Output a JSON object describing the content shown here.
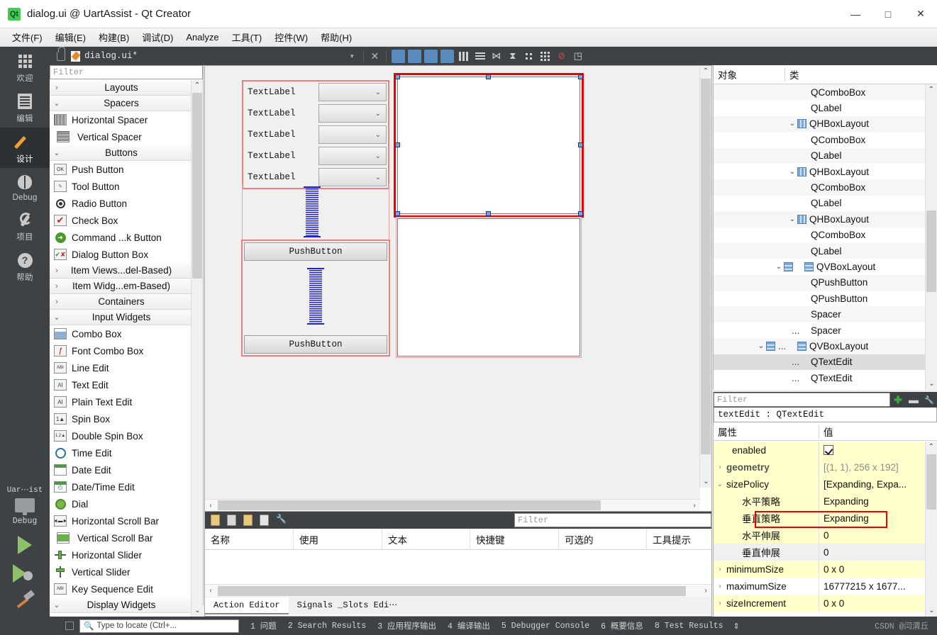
{
  "window": {
    "title": "dialog.ui @ UartAssist - Qt Creator",
    "logo_text": "Qt",
    "minimize": "—",
    "maximize": "□",
    "close": "✕"
  },
  "menubar": {
    "items": [
      {
        "label": "文件(F)",
        "mnemonic": "F"
      },
      {
        "label": "编辑(E)",
        "mnemonic": "E"
      },
      {
        "label": "构建(B)",
        "mnemonic": "B"
      },
      {
        "label": "调试(D)",
        "mnemonic": "D"
      },
      {
        "label": "Analyze",
        "mnemonic": "A"
      },
      {
        "label": "工具(T)",
        "mnemonic": "T"
      },
      {
        "label": "控件(W)",
        "mnemonic": "W"
      },
      {
        "label": "帮助(H)",
        "mnemonic": "H"
      }
    ]
  },
  "modebar": {
    "items": [
      {
        "label": "欢迎",
        "icon": "grid-icon",
        "active": false
      },
      {
        "label": "编辑",
        "icon": "document-icon",
        "active": false
      },
      {
        "label": "设计",
        "icon": "pencil-icon",
        "active": true
      },
      {
        "label": "Debug",
        "icon": "bug-icon",
        "active": false
      },
      {
        "label": "项目",
        "icon": "wrench-icon",
        "active": false
      },
      {
        "label": "帮助",
        "icon": "question-icon",
        "active": false
      }
    ],
    "kit": {
      "project": "Uar⋯ist",
      "build_config": "Debug"
    }
  },
  "editbar": {
    "filename": "dialog.ui*",
    "dropdown": "▾",
    "close": "✕"
  },
  "widgetbox": {
    "filter_placeholder": "Filter",
    "groups": [
      {
        "label": "Layouts",
        "expanded": false,
        "items": []
      },
      {
        "label": "Spacers",
        "expanded": true,
        "items": [
          {
            "label": "Horizontal Spacer",
            "icon": "horizontal-spacer-icon"
          },
          {
            "label": "Vertical Spacer",
            "icon": "vertical-spacer-icon"
          }
        ]
      },
      {
        "label": "Buttons",
        "expanded": true,
        "items": [
          {
            "label": "Push Button",
            "icon": "push-button-icon"
          },
          {
            "label": "Tool Button",
            "icon": "tool-button-icon"
          },
          {
            "label": "Radio Button",
            "icon": "radio-button-icon"
          },
          {
            "label": "Check Box",
            "icon": "check-box-icon"
          },
          {
            "label": "Command ...k Button",
            "icon": "command-link-icon"
          },
          {
            "label": "Dialog Button Box",
            "icon": "dialog-button-box-icon"
          }
        ]
      },
      {
        "label": "Item Views...del-Based)",
        "expanded": false,
        "items": []
      },
      {
        "label": "Item Widg...em-Based)",
        "expanded": false,
        "items": []
      },
      {
        "label": "Containers",
        "expanded": false,
        "items": []
      },
      {
        "label": "Input Widgets",
        "expanded": true,
        "items": [
          {
            "label": "Combo Box",
            "icon": "combo-box-icon"
          },
          {
            "label": "Font Combo Box",
            "icon": "font-combo-box-icon"
          },
          {
            "label": "Line Edit",
            "icon": "line-edit-icon"
          },
          {
            "label": "Text Edit",
            "icon": "text-edit-icon"
          },
          {
            "label": "Plain Text Edit",
            "icon": "plain-text-edit-icon"
          },
          {
            "label": "Spin Box",
            "icon": "spin-box-icon"
          },
          {
            "label": "Double Spin Box",
            "icon": "double-spin-box-icon"
          },
          {
            "label": "Time Edit",
            "icon": "time-edit-icon"
          },
          {
            "label": "Date Edit",
            "icon": "date-edit-icon"
          },
          {
            "label": "Date/Time Edit",
            "icon": "date-time-edit-icon"
          },
          {
            "label": "Dial",
            "icon": "dial-icon"
          },
          {
            "label": "Horizontal Scroll Bar",
            "icon": "horizontal-scroll-bar-icon"
          },
          {
            "label": "Vertical Scroll Bar",
            "icon": "vertical-scroll-bar-icon"
          },
          {
            "label": "Horizontal Slider",
            "icon": "horizontal-slider-icon"
          },
          {
            "label": "Vertical Slider",
            "icon": "vertical-slider-icon"
          },
          {
            "label": "Key Sequence Edit",
            "icon": "key-sequence-edit-icon"
          }
        ]
      },
      {
        "label": "Display Widgets",
        "expanded": true,
        "items": []
      }
    ]
  },
  "canvas": {
    "labels": [
      "TextLabel",
      "TextLabel",
      "TextLabel",
      "TextLabel",
      "TextLabel"
    ],
    "buttons": [
      "PushButton",
      "PushButton"
    ],
    "selected_widget": "textEdit"
  },
  "object_inspector": {
    "col_object": "对象",
    "col_class": "类",
    "rows": [
      {
        "object": "",
        "cls": "QComboBox",
        "depth": 3,
        "chev": "",
        "icon": ""
      },
      {
        "object": "",
        "cls": "QLabel",
        "depth": 3,
        "chev": "",
        "icon": ""
      },
      {
        "object": "",
        "cls": "QHBoxLayout",
        "depth": 2,
        "chev": "⌄",
        "icon": "hbox"
      },
      {
        "object": "",
        "cls": "QComboBox",
        "depth": 3,
        "chev": "",
        "icon": ""
      },
      {
        "object": "",
        "cls": "QLabel",
        "depth": 3,
        "chev": "",
        "icon": ""
      },
      {
        "object": "",
        "cls": "QHBoxLayout",
        "depth": 2,
        "chev": "⌄",
        "icon": "hbox"
      },
      {
        "object": "",
        "cls": "QComboBox",
        "depth": 3,
        "chev": "",
        "icon": ""
      },
      {
        "object": "",
        "cls": "QLabel",
        "depth": 3,
        "chev": "",
        "icon": ""
      },
      {
        "object": "",
        "cls": "QHBoxLayout",
        "depth": 2,
        "chev": "⌄",
        "icon": "hbox"
      },
      {
        "object": "",
        "cls": "QComboBox",
        "depth": 3,
        "chev": "",
        "icon": ""
      },
      {
        "object": "",
        "cls": "QLabel",
        "depth": 3,
        "chev": "",
        "icon": ""
      },
      {
        "object": "",
        "cls": "QVBoxLayout",
        "depth": 2,
        "chev": "⌄",
        "icon": "vbox2"
      },
      {
        "object": "",
        "cls": "QPushButton",
        "depth": 3,
        "chev": "",
        "icon": ""
      },
      {
        "object": "",
        "cls": "QPushButton",
        "depth": 3,
        "chev": "",
        "icon": ""
      },
      {
        "object": "",
        "cls": "Spacer",
        "depth": 3,
        "chev": "",
        "icon": ""
      },
      {
        "object": "...",
        "cls": "Spacer",
        "depth": 3,
        "chev": "",
        "icon": ""
      },
      {
        "object": "...",
        "cls": "QVBoxLayout",
        "depth": 1,
        "chev": "⌄",
        "icon": "vbox2"
      },
      {
        "object": "...",
        "cls": "QTextEdit",
        "depth": 2,
        "chev": "",
        "icon": "",
        "selected": true
      },
      {
        "object": "...",
        "cls": "QTextEdit",
        "depth": 2,
        "chev": "",
        "icon": ""
      }
    ]
  },
  "property_editor": {
    "filter_placeholder": "Filter",
    "object_line": "textEdit : QTextEdit",
    "col_property": "属性",
    "col_value": "值",
    "toolbar": {
      "add": "✚",
      "remove": "▬",
      "config": "🔧"
    },
    "rows": [
      {
        "name": "enabled",
        "value": "",
        "indent": 1,
        "chev": "",
        "bg": "yellow",
        "kind": "checkbox"
      },
      {
        "name": "geometry",
        "value": "[(1, 1), 256 x 192]",
        "indent": 0,
        "chev": "›",
        "bg": "yellow",
        "bold": true,
        "grayvalue": true
      },
      {
        "name": "sizePolicy",
        "value": "[Expanding, Expa...",
        "indent": 0,
        "chev": "⌄",
        "bg": "yellow"
      },
      {
        "name": "水平策略",
        "value": "Expanding",
        "indent": 2,
        "chev": "",
        "bg": "yellow"
      },
      {
        "name": "垂直策略",
        "value": "Expanding",
        "indent": 2,
        "chev": "",
        "bg": "yellow"
      },
      {
        "name": "水平伸展",
        "value": "0",
        "indent": 2,
        "chev": "",
        "bg": "yellow"
      },
      {
        "name": "垂直伸展",
        "value": "0",
        "indent": 2,
        "chev": "",
        "bg": "gray",
        "highlighted": true
      },
      {
        "name": "minimumSize",
        "value": "0 x 0",
        "indent": 0,
        "chev": "›",
        "bg": "yellow"
      },
      {
        "name": "maximumSize",
        "value": "16777215 x 1677...",
        "indent": 0,
        "chev": "›",
        "bg": "white"
      },
      {
        "name": "sizeIncrement",
        "value": "0 x 0",
        "indent": 0,
        "chev": "›",
        "bg": "yellow"
      }
    ]
  },
  "action_editor": {
    "filter_placeholder": "Filter",
    "columns": [
      "名称",
      "使用",
      "文本",
      "快捷键",
      "可选的",
      "工具提示"
    ],
    "tabs": [
      {
        "label": "Action Editor",
        "active": true
      },
      {
        "label": "Signals _Slots Edi⋯",
        "active": false
      }
    ]
  },
  "statusbar": {
    "locate_placeholder": "Type to locate (Ctrl+...",
    "search_icon": "search-icon",
    "entries": [
      "1 问题",
      "2 Search Results",
      "3 应用程序输出",
      "4 编译输出",
      "5 Debugger Console",
      "6 概要信息",
      "8 Test Results"
    ],
    "updown": "⇕",
    "credit": "CSDN @闫渭丘"
  },
  "colors": {
    "accent_green": "#41cd52",
    "dark_panel": "#3f4244",
    "selection_red": "#f00000",
    "layout_red": "#f08080",
    "handle_blue": "#7f9fd9",
    "spacer_blue": "#2222cc",
    "property_yellow": "#ffffcc"
  }
}
